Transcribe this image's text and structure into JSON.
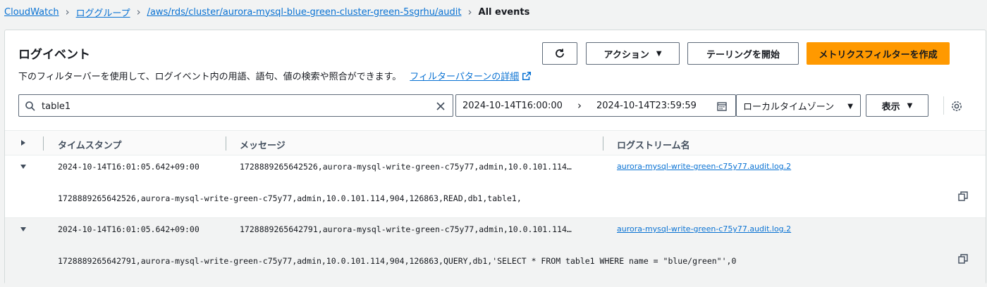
{
  "breadcrumb": {
    "items": [
      "CloudWatch",
      "ロググループ",
      "/aws/rds/cluster/aurora-mysql-blue-green-cluster-green-5sgrhu/audit"
    ],
    "current": "All events"
  },
  "header": {
    "title": "ログイベント",
    "description": "下のフィルターバーを使用して、ログイベント内の用語、語句、値の検索や照合ができます。",
    "link_label": "フィルターパターンの詳細"
  },
  "toolbar": {
    "actions_label": "アクション",
    "tail_label": "テーリングを開始",
    "metric_filter_label": "メトリクスフィルターを作成"
  },
  "filter": {
    "search_value": "table1",
    "date_start": "2024-10-14T16:00:00",
    "date_end": "2024-10-14T23:59:59",
    "timezone_label": "ローカルタイムゾーン",
    "display_label": "表示"
  },
  "table": {
    "columns": [
      "タイムスタンプ",
      "メッセージ",
      "ログストリーム名"
    ],
    "rows": [
      {
        "timestamp": "2024-10-14T16:01:05.642+09:00",
        "message": "1728889265642526,aurora-mysql-write-green-c75y77,admin,10.0.101.114…",
        "stream": "aurora-mysql-write-green-c75y77.audit.log.2",
        "expanded": "1728889265642526,aurora-mysql-write-green-c75y77,admin,10.0.101.114,904,126863,READ,db1,table1,"
      },
      {
        "timestamp": "2024-10-14T16:01:05.642+09:00",
        "message": "1728889265642791,aurora-mysql-write-green-c75y77,admin,10.0.101.114…",
        "stream": "aurora-mysql-write-green-c75y77.audit.log.2",
        "expanded": "1728889265642791,aurora-mysql-write-green-c75y77,admin,10.0.101.114,904,126863,QUERY,db1,'SELECT * FROM table1 WHERE name = \"blue/green\"',0"
      }
    ]
  },
  "colors": {
    "link": "#0972d3",
    "primary": "#ff9900",
    "text": "#16191f",
    "border": "#5f6b7a",
    "background": "#f2f3f3"
  },
  "icons": [
    "refresh-icon",
    "search-icon",
    "clear-icon",
    "calendar-icon",
    "settings-icon",
    "external-link-icon",
    "copy-icon"
  ]
}
